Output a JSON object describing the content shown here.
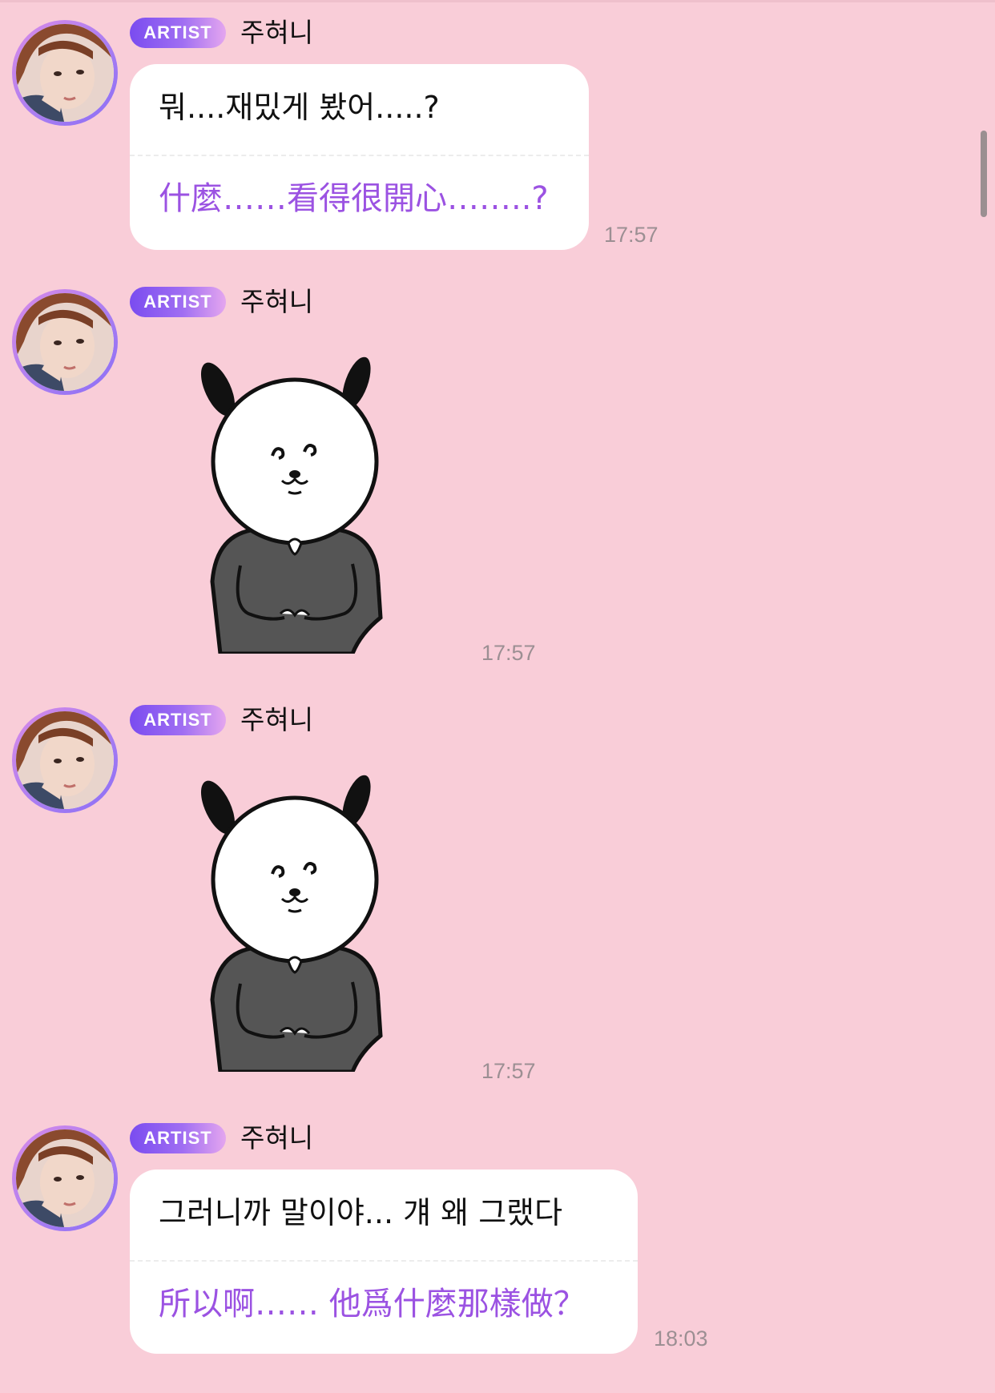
{
  "messages": [
    {
      "badge": "ARTIST",
      "sender": "주혀니",
      "type": "text",
      "text": "뭐....재밌게 봤어.....?",
      "translation": "什麼……看得很開心……..?",
      "time": "17:57"
    },
    {
      "badge": "ARTIST",
      "sender": "주혀니",
      "type": "sticker",
      "time": "17:57"
    },
    {
      "badge": "ARTIST",
      "sender": "주혀니",
      "type": "sticker",
      "time": "17:57"
    },
    {
      "badge": "ARTIST",
      "sender": "주혀니",
      "type": "text",
      "text": "그러니까 말이야... 걔 왜 그랬다",
      "translation": "所以啊…… 他爲什麼那樣做？",
      "time": "18:03"
    }
  ],
  "colors": {
    "background": "#f9cdd8",
    "bubble": "#ffffff",
    "translation_text": "#9b52e2",
    "badge_gradient": [
      "#7a4cf0",
      "#e4a6ef"
    ],
    "avatar_ring": "#a77cf2"
  },
  "icons": {
    "sticker": "bunny-sticker-icon",
    "avatar": "artist-avatar-icon"
  }
}
